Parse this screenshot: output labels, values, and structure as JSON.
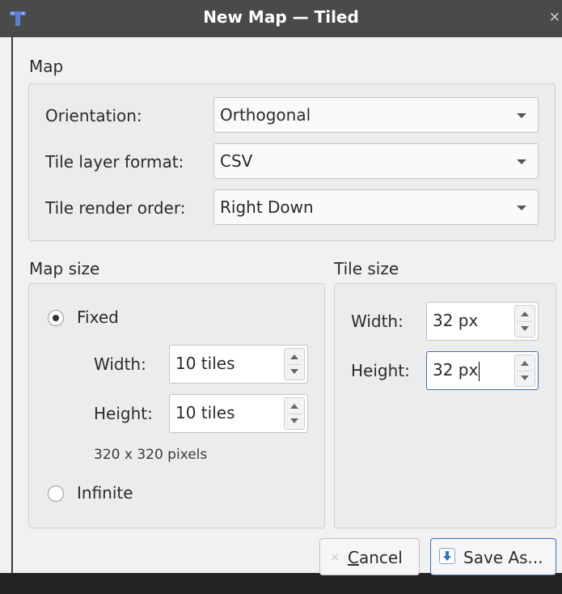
{
  "window": {
    "title": "New Map — Tiled",
    "close_glyph": "×",
    "app_icon": "tiled-app-icon"
  },
  "map_group": {
    "heading": "Map",
    "orientation": {
      "label": "Orientation:",
      "value": "Orthogonal"
    },
    "layer_format": {
      "label": "Tile layer format:",
      "value": "CSV"
    },
    "render_order": {
      "label": "Tile render order:",
      "value": "Right Down"
    }
  },
  "map_size": {
    "heading": "Map size",
    "fixed_label": "Fixed",
    "fixed_selected": true,
    "width_label": "Width:",
    "width_value": "10 tiles",
    "height_label": "Height:",
    "height_value": "10 tiles",
    "pixels_text": "320 x 320 pixels",
    "infinite_label": "Infinite",
    "infinite_selected": false
  },
  "tile_size": {
    "heading": "Tile size",
    "width_label": "Width:",
    "width_value": "32 px",
    "height_label": "Height:",
    "height_value": "32 px"
  },
  "buttons": {
    "cancel_prefix": "",
    "cancel_mnemonic": "C",
    "cancel_rest": "ancel",
    "cancel_icon": "close-icon",
    "save_label": "Save As...",
    "save_icon": "download-icon"
  },
  "colors": {
    "titlebar": "#4a4a4a",
    "dialog_bg": "#f1f1f1",
    "focus_border": "#3d6fb4",
    "save_icon_blue": "#2f73c9"
  }
}
